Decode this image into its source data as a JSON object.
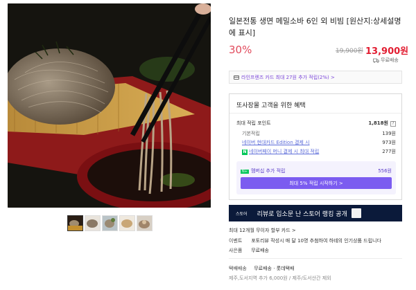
{
  "product": {
    "title": "일본전통 생면 메밀소바 6인 외 비빔 [원산지:상세설명에 표시]",
    "discount": "30%",
    "original_price": "19,900원",
    "sale_price": "13,900원",
    "shipping_tag": "무료배송"
  },
  "promo": {
    "text": "라인프렌즈 카드 최대 27원 추가 적립(2%) >"
  },
  "benefits": {
    "title": "또사장몰 고객을 위한 혜택",
    "rows": [
      {
        "label": "최대 적립 포인트",
        "value": "1,818원"
      },
      {
        "label": "기본적립",
        "value": "139원"
      },
      {
        "label": "네이버 현대카드 Edition 결제 시",
        "value": "973원"
      },
      {
        "label": "네이버페이 머니 결제 시 최대 적립",
        "value": "277원"
      }
    ],
    "membership": {
      "label": "멤버십 추가 적립",
      "value": "556원",
      "button": "최대 5% 적립 시작하기 >"
    }
  },
  "store_banner": {
    "logo": "스토어",
    "text": "리뷰로 입소문 난 스토어 랭킹 공개"
  },
  "info": {
    "installment": "최대 12개월 무이자 할부 카드 >",
    "event_label": "이벤트",
    "event_text": "포토리뷰 작성시 매 달 10명 추첨하여 하테의 인기상품 드립니다",
    "gift_label": "사은품",
    "gift_text": "무료배송",
    "delivery_label": "택배배송",
    "delivery_text": "무료배송 · 롯데택배",
    "delivery_extra": "제주,도서지역 추가 6,000원 / 제주/도서산간 제외"
  },
  "colors": {
    "accent_red": "#e21e32",
    "discount_pink": "#e14a5c",
    "naver_green": "#03c75a",
    "membership_purple": "#7b5cf0",
    "banner_navy": "#0b1a3a"
  },
  "icons": [
    "truck-icon",
    "card-icon",
    "question-icon",
    "naver-pay-icon",
    "store-logo-icon"
  ]
}
